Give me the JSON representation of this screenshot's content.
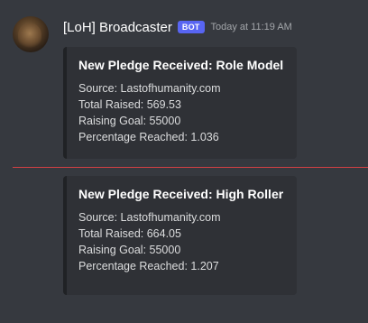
{
  "message": {
    "username": "[LoH] Broadcaster",
    "bot_tag": "BOT",
    "timestamp": "Today at 11:19 AM"
  },
  "embeds": [
    {
      "title": "New Pledge Received: Role Model",
      "source": "Source: Lastofhumanity.com",
      "total_raised": "Total Raised: 569.53",
      "raising_goal": "Raising Goal: 55000",
      "percentage": "Percentage Reached: 1.036"
    },
    {
      "title": "New Pledge Received: High Roller",
      "source": "Source: Lastofhumanity.com",
      "total_raised": "Total Raised: 664.05",
      "raising_goal": "Raising Goal: 55000",
      "percentage": "Percentage Reached: 1.207"
    }
  ],
  "colors": {
    "background": "#36393f",
    "embed_background": "#2f3136",
    "bot_tag": "#5865f2",
    "new_messages_divider": "#ed4245"
  }
}
